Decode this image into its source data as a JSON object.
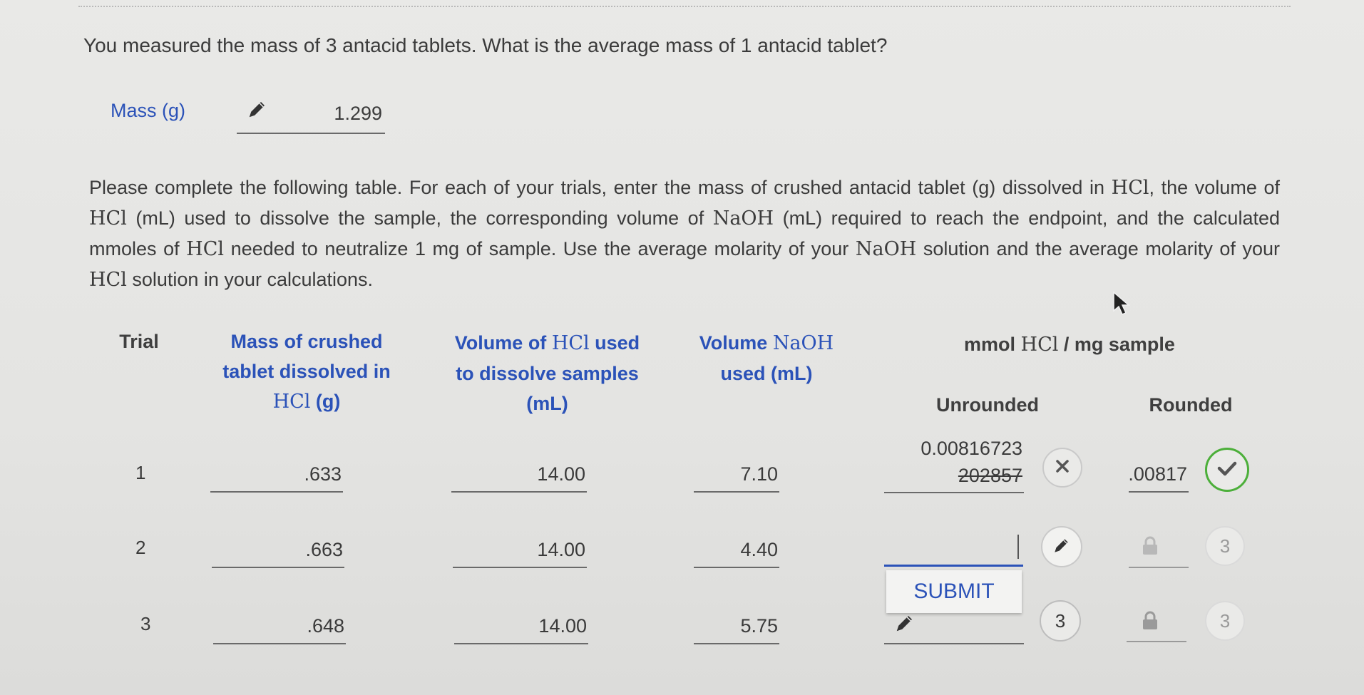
{
  "question": "You measured the mass of 3 antacid tablets. What is the average mass of 1 antacid tablet?",
  "mass": {
    "label": "Mass (g)",
    "value": "1.299"
  },
  "instructions": {
    "p1": "Please complete the following table. For each of your trials, enter the mass of crushed antacid tablet (g) dissolved in ",
    "hcl": "HCl",
    "p2": ", the volume of ",
    "p3": " (mL) used to dissolve the sample, the corresponding volume of ",
    "naoh": "NaOH",
    "p4": " (mL) required to reach the endpoint, and the calculated mmoles of ",
    "p5": " needed to neutralize 1 mg of sample. Use the average molarity of your ",
    "p6": " solution and the average molarity of your ",
    "p7": " solution in your calculations."
  },
  "table": {
    "headers": {
      "trial": "Trial",
      "mass_l1": "Mass of crushed",
      "mass_l2": "tablet dissolved in",
      "mass_chem": "HCl",
      "mass_unit": " (g)",
      "vol_hcl_a": "Volume of ",
      "vol_hcl_chem": "HCl",
      "vol_hcl_b": " used",
      "vol_hcl_l2": "to dissolve samples",
      "vol_hcl_l3": "(mL)",
      "naoh_a": "Volume ",
      "naoh_chem": "NaOH",
      "naoh_l2": "used (mL)",
      "mmol_a": "mmol ",
      "mmol_chem": "HCl",
      "mmol_b": " / mg sample",
      "unrounded": "Unrounded",
      "rounded": "Rounded"
    },
    "rows": [
      {
        "trial": "1",
        "mass": ".633",
        "vol_hcl": "14.00",
        "vol_naoh": "7.10",
        "unrounded_l1": "0.00816723",
        "unrounded_l2": "202857",
        "rounded": ".00817"
      },
      {
        "trial": "2",
        "mass": ".663",
        "vol_hcl": "14.00",
        "vol_naoh": "4.40",
        "unrounded": "",
        "rounded_attempts": "3"
      },
      {
        "trial": "3",
        "mass": ".648",
        "vol_hcl": "14.00",
        "vol_naoh": "5.75",
        "unrounded_attempts": "3",
        "rounded_attempts": "3"
      }
    ]
  },
  "submit_label": "SUBMIT",
  "icons": {
    "pencil": "pencil-icon",
    "check": "check-icon",
    "x": "x-icon",
    "lock": "lock-icon",
    "cursor": "mouse-pointer-icon"
  },
  "colors": {
    "accent": "#2b52b8",
    "success": "#4caf3a",
    "error": "#555555"
  }
}
